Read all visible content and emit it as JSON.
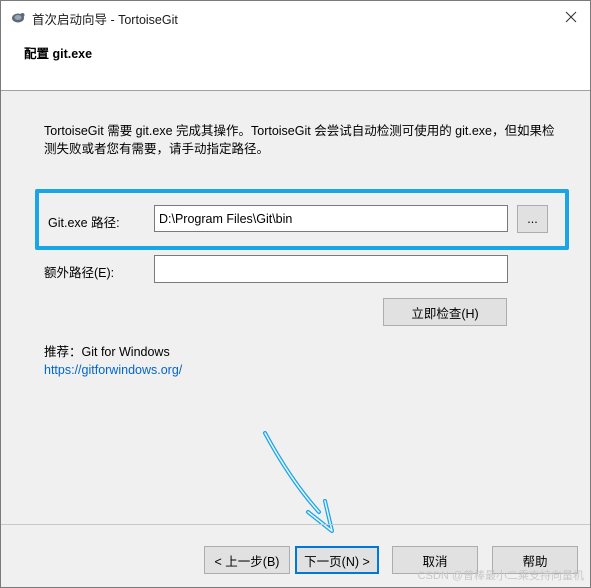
{
  "window": {
    "title": "首次启动向导 - TortoiseGit",
    "header_title": "配置 git.exe"
  },
  "description": "TortoiseGit 需要 git.exe 完成其操作。TortoiseGit 会尝试自动检测可使用的 git.exe，但如果检测失败或者您有需要，请手动指定路径。",
  "gitexe": {
    "label": "Git.exe 路径:",
    "value": "D:\\Program Files\\Git\\bin",
    "browse_label": "..."
  },
  "extra_path": {
    "label": "额外路径(E):",
    "value": ""
  },
  "check_button": "立即检查(H)",
  "recommend": {
    "label": "推荐：Git for Windows",
    "link": "https://gitforwindows.org/"
  },
  "footer": {
    "back": "< 上一步(B)",
    "next": "下一页(N) >",
    "cancel": "取消",
    "help": "帮助"
  },
  "watermark": "CSDN @曾棒最小二乘支持向量机",
  "colors": {
    "highlight": "#1aa5e6",
    "link": "#0066cc"
  }
}
